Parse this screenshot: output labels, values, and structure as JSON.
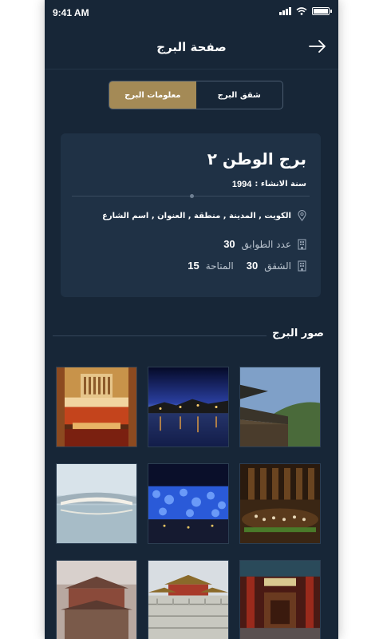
{
  "status_bar": {
    "time": "9:41 AM"
  },
  "header": {
    "title": "صفحة البرج"
  },
  "tabs": [
    {
      "label": "شقق البرج",
      "active": false
    },
    {
      "label": "معلومات البرج",
      "active": true
    }
  ],
  "tower": {
    "name": "برج الوطن ٢",
    "year_label": "سنة الانشاء :",
    "year_value": "1994",
    "address": "الكويت , المدينة , منطقة , العنوان , اسم الشارع",
    "floors_label": "عدد الطوابق",
    "floors_value": "30",
    "apartments_label": "الشقق",
    "apartments_value": "30",
    "available_label": "المتاحة",
    "available_value": "15"
  },
  "gallery": {
    "title": "صور البرج",
    "photos": [
      "concert-hall-photo",
      "night-lake-photo",
      "pagoda-roof-photo",
      "bridge-water-photo",
      "blue-cube-photo",
      "orchestra-photo",
      "palace-blur-photo",
      "palace-terrace-photo",
      "temple-interior-photo"
    ]
  },
  "colors": {
    "background": "#172637",
    "card": "#1f3145",
    "accent": "#a48a56"
  }
}
